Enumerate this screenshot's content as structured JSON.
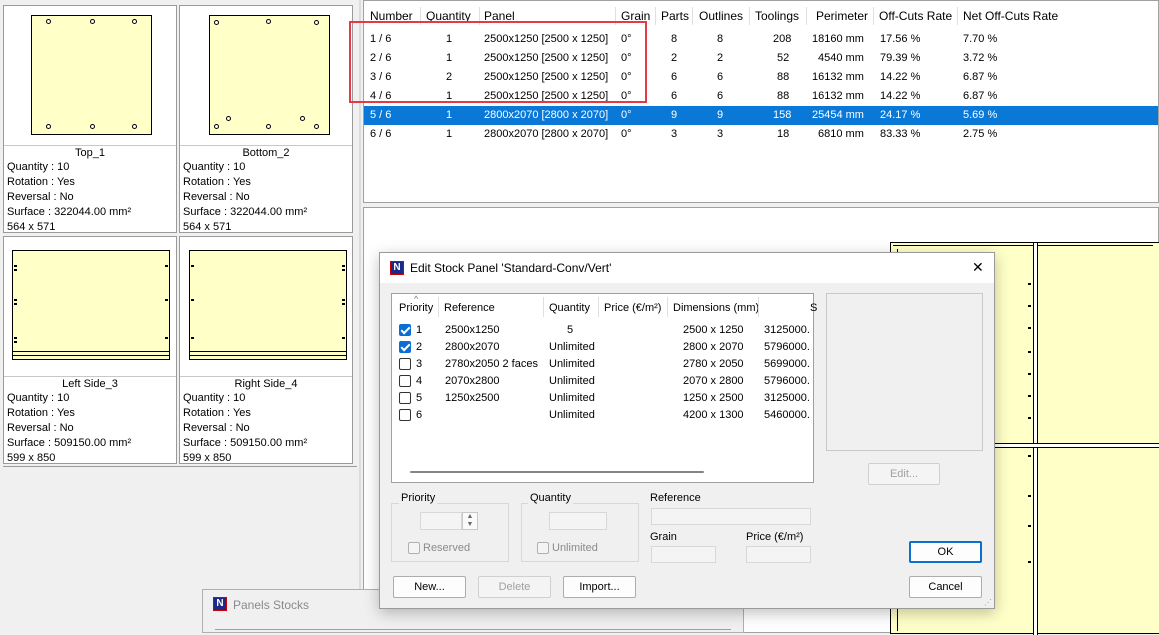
{
  "parts": [
    {
      "name": "Top_1",
      "quantity": "Quantity : 10",
      "rotation": "Rotation : Yes",
      "reversal": "Reversal : No",
      "surface": "Surface : 322044.00 mm²",
      "size": "564 x 571"
    },
    {
      "name": "Bottom_2",
      "quantity": "Quantity : 10",
      "rotation": "Rotation : Yes",
      "reversal": "Reversal : No",
      "surface": "Surface : 322044.00 mm²",
      "size": "564 x 571"
    },
    {
      "name": "Left Side_3",
      "quantity": "Quantity : 10",
      "rotation": "Rotation : Yes",
      "reversal": "Reversal : No",
      "surface": "Surface : 509150.00 mm²",
      "size": "599 x 850"
    },
    {
      "name": "Right Side_4",
      "quantity": "Quantity : 10",
      "rotation": "Rotation : Yes",
      "reversal": "Reversal : No",
      "surface": "Surface : 509150.00 mm²",
      "size": "599 x 850"
    }
  ],
  "results": {
    "headers": [
      "Number",
      "Quantity",
      "Panel",
      "Grain",
      "Parts",
      "Outlines",
      "Toolings",
      "Perimeter",
      "Off-Cuts Rate",
      "Net Off-Cuts Rate"
    ],
    "rows": [
      [
        "1 / 6",
        "1",
        "2500x1250 [2500 x 1250]",
        "0°",
        "8",
        "8",
        "208",
        "18160 mm",
        "17.56 %",
        "7.70 %"
      ],
      [
        "2 / 6",
        "1",
        "2500x1250 [2500 x 1250]",
        "0°",
        "2",
        "2",
        "52",
        "4540 mm",
        "79.39 %",
        "3.72 %"
      ],
      [
        "3 / 6",
        "2",
        "2500x1250 [2500 x 1250]",
        "0°",
        "6",
        "6",
        "88",
        "16132 mm",
        "14.22 %",
        "6.87 %"
      ],
      [
        "4 / 6",
        "1",
        "2500x1250 [2500 x 1250]",
        "0°",
        "6",
        "6",
        "88",
        "16132 mm",
        "14.22 %",
        "6.87 %"
      ],
      [
        "5 / 6",
        "1",
        "2800x2070 [2800 x 2070]",
        "0°",
        "9",
        "9",
        "158",
        "25454 mm",
        "24.17 %",
        "5.69 %"
      ],
      [
        "6 / 6",
        "1",
        "2800x2070 [2800 x 2070]",
        "0°",
        "3",
        "3",
        "18",
        "6810 mm",
        "83.33 %",
        "2.75 %"
      ]
    ],
    "selected_row": "5 / 6"
  },
  "dialog": {
    "title": "Edit Stock Panel 'Standard-Conv/Vert'",
    "close_glyph": "✕",
    "logo_glyph": "N",
    "list_headers": [
      "Priority",
      "Reference",
      "Quantity",
      "Price (€/m²)",
      "Dimensions (mm)",
      "S"
    ],
    "list_rows": [
      {
        "checked": true,
        "priority": "1",
        "reference": "2500x1250",
        "quantity": "5",
        "price": "",
        "dimensions": "2500 x 1250",
        "surface": "3125000."
      },
      {
        "checked": true,
        "priority": "2",
        "reference": "2800x2070",
        "quantity": "Unlimited",
        "price": "",
        "dimensions": "2800 x 2070",
        "surface": "5796000."
      },
      {
        "checked": false,
        "priority": "3",
        "reference": "2780x2050 2 faces",
        "quantity": "Unlimited",
        "price": "",
        "dimensions": "2780 x 2050",
        "surface": "5699000."
      },
      {
        "checked": false,
        "priority": "4",
        "reference": "2070x2800",
        "quantity": "Unlimited",
        "price": "",
        "dimensions": "2070 x 2800",
        "surface": "5796000."
      },
      {
        "checked": false,
        "priority": "5",
        "reference": "1250x2500",
        "quantity": "Unlimited",
        "price": "",
        "dimensions": "1250 x 2500",
        "surface": "3125000."
      },
      {
        "checked": false,
        "priority": "6",
        "reference": "",
        "quantity": "Unlimited",
        "price": "",
        "dimensions": "4200 x 1300",
        "surface": "5460000."
      }
    ],
    "edit_label": "Edit...",
    "priority_label": "Priority",
    "reserved_label": "Reserved",
    "quantity_label": "Quantity",
    "unlimited_label": "Unlimited",
    "reference_label": "Reference",
    "grain_label": "Grain",
    "price_label": "Price (€/m²)",
    "ok_label": "OK",
    "cancel_label": "Cancel",
    "new_label": "New...",
    "delete_label": "Delete",
    "import_label": "Import..."
  },
  "panels_stocks": {
    "title": "Panels Stocks",
    "logo_glyph": "N"
  },
  "colors": {
    "accent": "#0a78d7",
    "highlight": "#e53a44",
    "part_fill": "#ffffc8"
  }
}
